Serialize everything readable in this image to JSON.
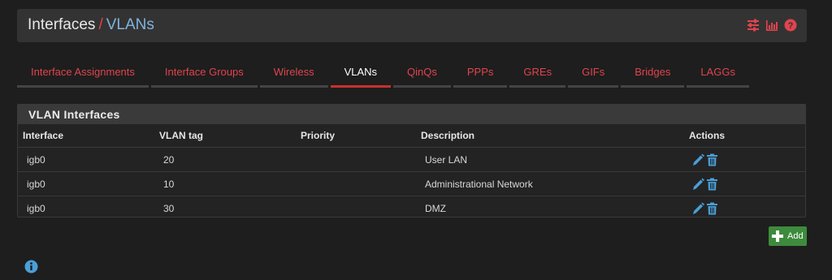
{
  "breadcrumb": {
    "parent": "Interfaces",
    "separator": "/",
    "current": "VLANs"
  },
  "header_icons": [
    "sliders-icon",
    "bar-chart-icon",
    "help-icon"
  ],
  "tabs": [
    {
      "label": "Interface Assignments",
      "active": false
    },
    {
      "label": "Interface Groups",
      "active": false
    },
    {
      "label": "Wireless",
      "active": false
    },
    {
      "label": "VLANs",
      "active": true
    },
    {
      "label": "QinQs",
      "active": false
    },
    {
      "label": "PPPs",
      "active": false
    },
    {
      "label": "GREs",
      "active": false
    },
    {
      "label": "GIFs",
      "active": false
    },
    {
      "label": "Bridges",
      "active": false
    },
    {
      "label": "LAGGs",
      "active": false
    }
  ],
  "panel": {
    "title": "VLAN Interfaces",
    "columns": [
      "Interface",
      "VLAN tag",
      "Priority",
      "Description",
      "Actions"
    ],
    "rows": [
      {
        "interface": "igb0",
        "tag": "20",
        "priority": "",
        "description": "User LAN"
      },
      {
        "interface": "igb0",
        "tag": "10",
        "priority": "",
        "description": "Administrational Network"
      },
      {
        "interface": "igb0",
        "tag": "30",
        "priority": "",
        "description": "DMZ"
      }
    ]
  },
  "add_button": {
    "label": "Add"
  },
  "colors": {
    "accent_red": "#e0444e",
    "link_blue": "#7fb3de",
    "action_blue": "#4a9fd8",
    "add_green": "#3d8b3d"
  }
}
